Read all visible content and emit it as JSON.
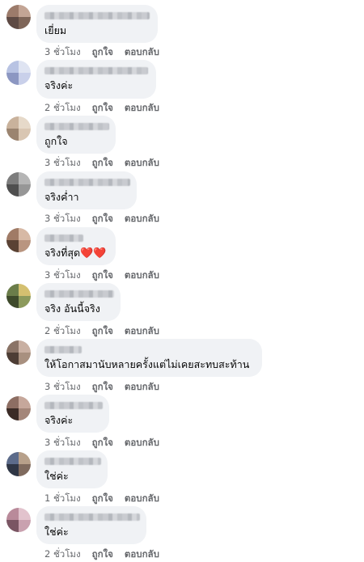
{
  "comments": [
    {
      "text": "เยี่ยม",
      "time": "3 ชั่วโมง",
      "like": "ถูกใจ",
      "reply": "ตอบกลับ",
      "avatar_colors": [
        "#9c7b6b",
        "#c3a595",
        "#5e4a44"
      ]
    },
    {
      "text": "จริงค่ะ",
      "time": "2 ชั่วโมง",
      "like": "ถูกใจ",
      "reply": "ตอบกลับ",
      "avatar_colors": [
        "#b8c3e3",
        "#dfe4f2",
        "#8c97c2"
      ]
    },
    {
      "text": "ถูกใจ",
      "time": "3 ชั่วโมง",
      "like": "ถูกใจ",
      "reply": "ตอบกลับ",
      "avatar_colors": [
        "#c9b29c",
        "#e6d9c9",
        "#9b8470"
      ]
    },
    {
      "text": "จริงค่ำา",
      "time": "3 ชั่วโมง",
      "like": "ถูกใจ",
      "reply": "ตอบกลับ",
      "avatar_colors": [
        "#7d7d7d",
        "#b5b5b5",
        "#4f4f4f"
      ]
    },
    {
      "text": "จริงที่สุด",
      "hearts": "❤️❤️",
      "time": "3 ชั่วโมง",
      "like": "ถูกใจ",
      "reply": "ตอบกลับ",
      "avatar_colors": [
        "#a07b66",
        "#d7b9a5",
        "#5a4234"
      ]
    },
    {
      "text": "จริง อันนี้จริง",
      "time": "2 ชั่วโมง",
      "like": "ถูกใจ",
      "reply": "ตอบกลับ",
      "avatar_colors": [
        "#6b7d4a",
        "#d4c070",
        "#3e4a2b"
      ]
    },
    {
      "text": "ให้โอกาสมานับหลายครั้งแต่ไม่เคยสะทบสะท้าน",
      "time": "3 ชั่วโมง",
      "like": "ถูกใจ",
      "reply": "ตอบกลับ",
      "avatar_colors": [
        "#8a7366",
        "#c9b0a2",
        "#4d3d35"
      ]
    },
    {
      "text": "จริงค่ะ",
      "time": "3 ชั่วโมง",
      "like": "ถูกใจ",
      "reply": "ตอบกลับ",
      "avatar_colors": [
        "#8d6e63",
        "#c6a79b",
        "#3b2b26"
      ]
    },
    {
      "text": "ใช่ค่ะ",
      "time": "1 ชั่วโมง",
      "like": "ถูกใจ",
      "reply": "ตอบกลับ",
      "avatar_colors": [
        "#5c6b8a",
        "#b7a08a",
        "#2f3645"
      ]
    },
    {
      "text": "ใช่ค่ะ",
      "time": "2 ชั่วโมง",
      "like": "ถูกใจ",
      "reply": "ตอบกลับ",
      "avatar_colors": [
        "#b98a9a",
        "#e2c3cd",
        "#7a5563"
      ]
    }
  ]
}
